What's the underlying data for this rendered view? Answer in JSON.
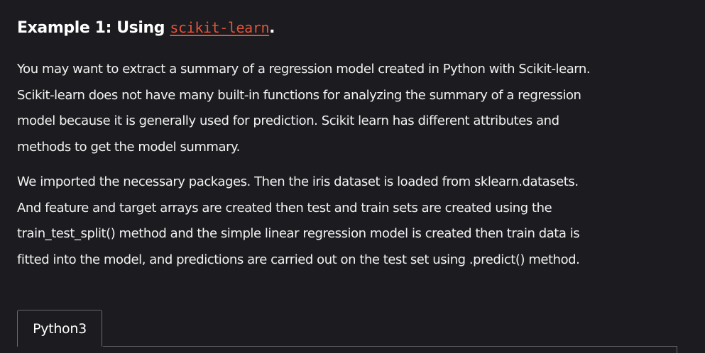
{
  "heading": {
    "prefix": "Example 1: Using",
    "link": "scikit-learn",
    "suffix": "."
  },
  "paragraph1": {
    "lines": [
      "You may want to extract a summary of a regression model created in Python with Scikit-learn.",
      "Scikit-learn does not have many built-in functions for analyzing the summary of a regression",
      "model because it is generally used for prediction. Scikit learn has different attributes and",
      "methods to get the model summary."
    ]
  },
  "paragraph2": {
    "lines": [
      "We imported the necessary packages. Then the iris dataset is loaded from sklearn.datasets.",
      "And feature and target arrays are created then test and train sets are created using the",
      "train_test_split() method and the simple linear regression model is created then train data is",
      "fitted into the model, and predictions are carried out on the test set using .predict() method."
    ]
  },
  "code_tabs": {
    "active_tab": "Python3"
  },
  "colors": {
    "background": "#1c1b1f",
    "text": "#ffffff",
    "link": "#e0553a",
    "border": "#6a6a6e"
  }
}
